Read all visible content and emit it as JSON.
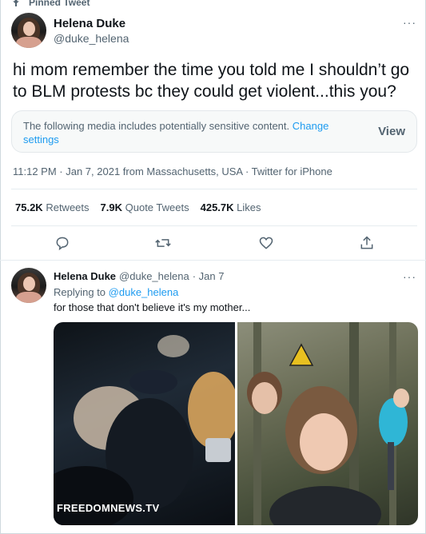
{
  "pinned_label": "Pinned Tweet",
  "main_tweet": {
    "author_name": "Helena Duke",
    "author_handle": "@duke_helena",
    "text": "hi mom remember the time you told me I shouldn’t go to BLM protests bc they could get violent...this you?",
    "sensitive_notice": "The following media includes potentially sensitive content.",
    "sensitive_link": "Change settings",
    "view_label": "View",
    "timestamp": "11:12 PM · Jan 7, 2021 from Massachusetts, USA · Twitter for iPhone",
    "stats": {
      "retweets_count": "75.2K",
      "retweets_label": "Retweets",
      "quote_count": "7.9K",
      "quote_label": "Quote Tweets",
      "likes_count": "425.7K",
      "likes_label": "Likes"
    },
    "more_glyph": "···"
  },
  "reply_tweet": {
    "author_name": "Helena Duke",
    "author_handle": "@duke_helena",
    "date": "· Jan 7",
    "replying_prefix": "Replying to",
    "replying_handle": "@duke_helena",
    "text": "for those that don't believe it's my mother...",
    "more_glyph": "···",
    "media_watermark": "FREEDOMNEWS.TV"
  },
  "icons": [
    "pin-icon",
    "reply-icon",
    "retweet-icon",
    "like-icon",
    "share-icon",
    "more-icon",
    "warning-sign-icon"
  ],
  "colors": {
    "link": "#1d9bf0",
    "secondary": "#536471",
    "primary": "#0f1419"
  }
}
